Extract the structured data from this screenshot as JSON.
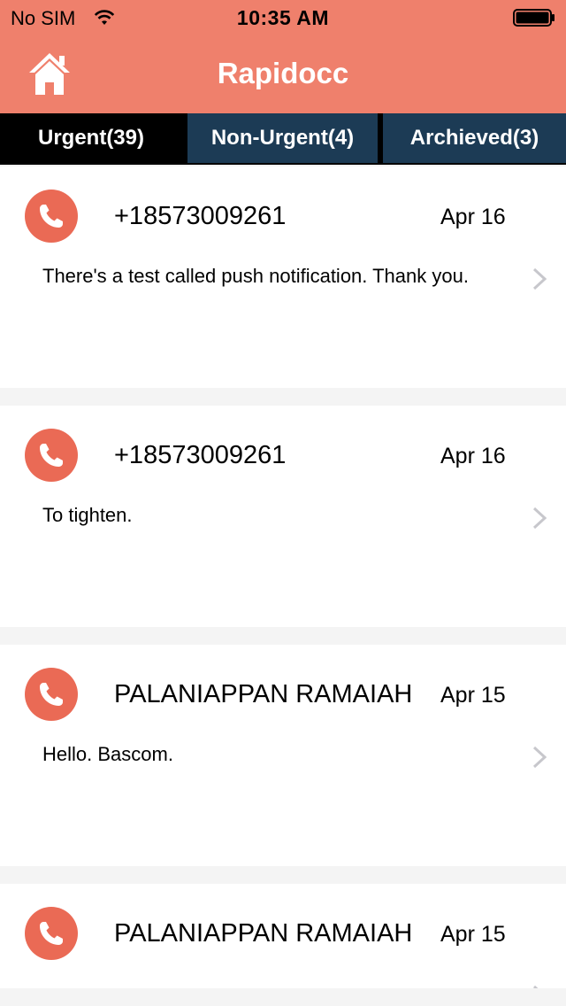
{
  "status_bar": {
    "carrier": "No SIM",
    "time": "10:35 AM"
  },
  "header": {
    "title": "Rapidocc",
    "background_color": "#ef806c",
    "home_icon": "home-icon"
  },
  "tabs": [
    {
      "label": "Urgent(39)",
      "active": true
    },
    {
      "label": "Non-Urgent(4)",
      "active": false
    },
    {
      "label": "Archieved(3)",
      "active": false
    }
  ],
  "messages": [
    {
      "caller": "+18573009261",
      "date": "Apr 16",
      "text": "There's a test called push notification.  Thank you."
    },
    {
      "caller": "+18573009261",
      "date": "Apr 16",
      "text": "To tighten."
    },
    {
      "caller": "PALANIAPPAN RAMAIAH",
      "date": "Apr 15",
      "text": "Hello.  Bascom."
    },
    {
      "caller": "PALANIAPPAN RAMAIAH",
      "date": "Apr 15",
      "text": ""
    }
  ],
  "colors": {
    "accent": "#ef806c",
    "phone_icon_bg": "#ea6a55",
    "tab_inactive": "#1c3b55",
    "tab_active": "#000000"
  }
}
